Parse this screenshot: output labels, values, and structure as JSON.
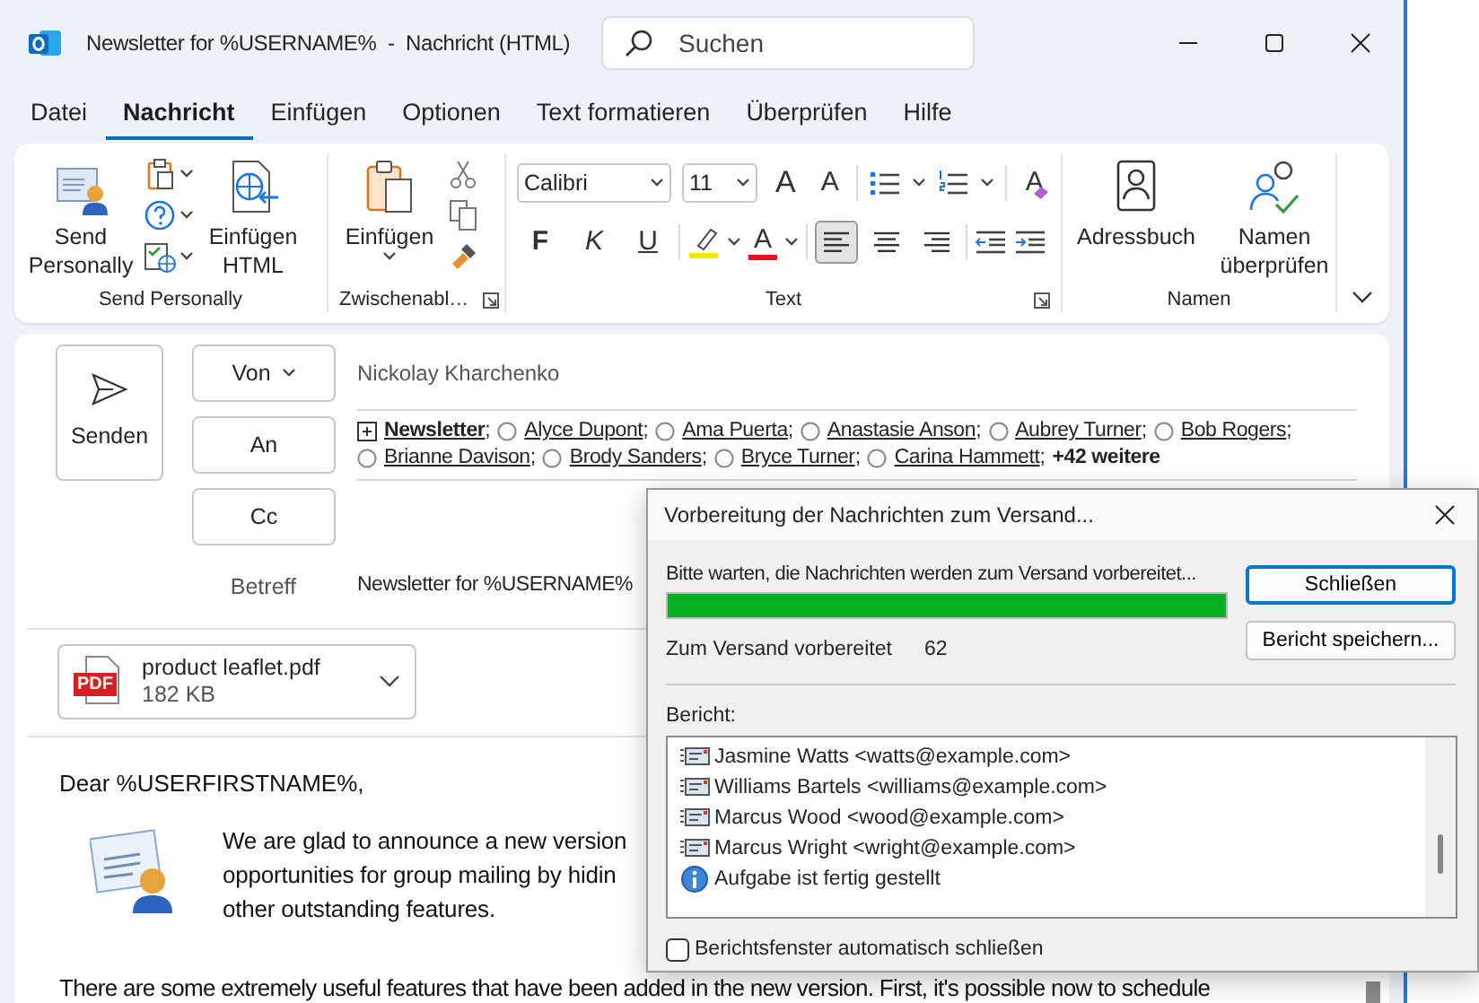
{
  "window": {
    "title": "Newsletter for %USERNAME%  -  Nachricht (HTML)"
  },
  "search": {
    "placeholder": "Suchen"
  },
  "menu_tabs": [
    {
      "label": "Datei",
      "selected": false
    },
    {
      "label": "Nachricht",
      "selected": true
    },
    {
      "label": "Einfügen",
      "selected": false
    },
    {
      "label": "Optionen",
      "selected": false
    },
    {
      "label": "Text formatieren",
      "selected": false
    },
    {
      "label": "Überprüfen",
      "selected": false
    },
    {
      "label": "Hilfe",
      "selected": false
    }
  ],
  "ribbon": {
    "send_group": {
      "label": "Send Personally",
      "send_personally": "Send Personally",
      "insert_html": "Einfügen HTML"
    },
    "clipboard_group": {
      "label": "Zwischenabl…",
      "paste": "Einfügen"
    },
    "text_group": {
      "label": "Text",
      "font": "Calibri",
      "size": "11",
      "grow": "A",
      "shrink": "A",
      "clear": "A",
      "font_color": "A",
      "styles": [
        {
          "label": "F",
          "kind": "bold"
        },
        {
          "label": "K",
          "kind": "italic"
        },
        {
          "label": "U",
          "kind": "underline"
        }
      ],
      "align": [
        {
          "kind": "left",
          "selected": true
        },
        {
          "kind": "center",
          "selected": false
        },
        {
          "kind": "right",
          "selected": false
        }
      ]
    },
    "names_group": {
      "label": "Namen",
      "address_book": "Adressbuch",
      "check_names": "Namen überprüfen"
    }
  },
  "header": {
    "send": "Senden",
    "from_button": "Von",
    "from": "Nickolay Kharchenko",
    "to_button": "An",
    "separator": ";",
    "recipients": [
      {
        "name": "Newsletter",
        "kind": "group"
      },
      {
        "name": "Alyce Dupont",
        "kind": "contact"
      },
      {
        "name": "Ama Puerta",
        "kind": "contact"
      },
      {
        "name": "Anastasie Anson",
        "kind": "contact"
      },
      {
        "name": "Aubrey Turner",
        "kind": "contact"
      },
      {
        "name": "Bob Rogers",
        "kind": "contact"
      },
      {
        "name": "Brianne Davison",
        "kind": "contact"
      },
      {
        "name": "Brody Sanders",
        "kind": "contact"
      },
      {
        "name": "Bryce Turner",
        "kind": "contact"
      },
      {
        "name": "Carina Hammett",
        "kind": "contact"
      }
    ],
    "more": "+42 weitere",
    "cc_button": "Cc",
    "subject_label": "Betreff",
    "subject": "Newsletter for %USERNAME%"
  },
  "attachment": {
    "name": "product leaflet.pdf",
    "size": "182 KB",
    "type_label": "PDF"
  },
  "body": {
    "greeting": "Dear %USERFIRSTNAME%,",
    "intro_lines": [
      "We are glad to announce a new version",
      "opportunities for group mailing by hidin",
      "other outstanding features."
    ],
    "paragraph": "There are some extremely useful features that have been added in the new version. First, it's possible now to schedule"
  },
  "dialog": {
    "title": "Vorbereitung der Nachrichten zum Versand...",
    "status": "Bitte warten, die Nachrichten werden zum Versand vorbereitet...",
    "level": 1,
    "count_label": "Zum Versand vorbereitet",
    "count": "62",
    "buttons": [
      {
        "label": "Schließen",
        "focused": true
      },
      {
        "label": "Bericht speichern...",
        "focused": false
      }
    ],
    "report_label": "Bericht:",
    "report": [
      {
        "kind": "mail",
        "text": "Jasmine Watts <watts@example.com>"
      },
      {
        "kind": "mail",
        "text": "Williams Bartels <williams@example.com>"
      },
      {
        "kind": "mail",
        "text": "Marcus Wood <wood@example.com>"
      },
      {
        "kind": "mail",
        "text": "Marcus Wright <wright@example.com>"
      },
      {
        "kind": "info",
        "text": "Aufgabe ist fertig gestellt"
      }
    ],
    "auto_close": {
      "label": "Berichtsfenster automatisch schließen",
      "checked": false
    }
  }
}
